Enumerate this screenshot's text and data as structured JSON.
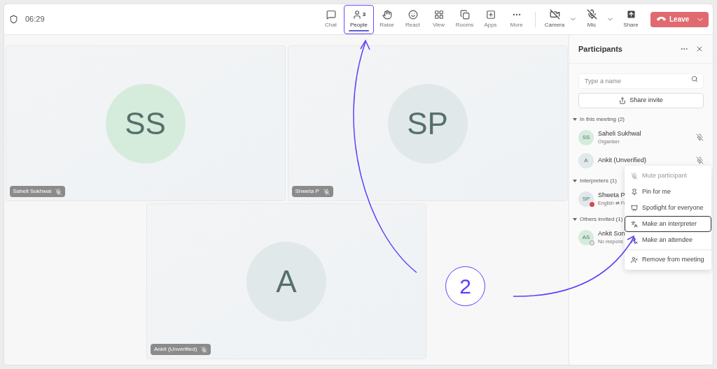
{
  "top_bar": {
    "timer": "06:29",
    "toolbar": [
      {
        "label": "Chat",
        "kind": "chat",
        "selected": false
      },
      {
        "label": "People",
        "kind": "people",
        "badge": "3",
        "selected": true,
        "outlined": true
      },
      {
        "label": "Raise",
        "kind": "raise",
        "selected": false
      },
      {
        "label": "React",
        "kind": "react",
        "selected": false
      },
      {
        "label": "View",
        "kind": "view",
        "selected": false
      },
      {
        "label": "Rooms",
        "kind": "rooms",
        "selected": false
      },
      {
        "label": "Apps",
        "kind": "apps",
        "selected": false
      },
      {
        "label": "More",
        "kind": "more",
        "selected": false
      }
    ],
    "devices": [
      {
        "label": "Camera",
        "kind": "camera",
        "on": false
      },
      {
        "label": "Mic",
        "kind": "mic",
        "on": false
      }
    ],
    "share": "Share",
    "leave": "Leave"
  },
  "tiles": [
    {
      "initials": "SS",
      "name": "Saheli Sukhwal",
      "color": "#d5ecdc",
      "muted": true
    },
    {
      "initials": "SP",
      "name": "Shweta P",
      "color": "#e1e8e9",
      "muted": true
    },
    {
      "initials": "A",
      "name": "Ankit (Unverified)",
      "color": "#e1e8e9",
      "muted": true
    }
  ],
  "panel": {
    "title": "Participants",
    "search": {
      "placeholder": "Type a name"
    },
    "share_invite": "Share invite",
    "sections": [
      {
        "title": "In this meeting (2)",
        "expanded": true,
        "people": [
          {
            "initials": "SS",
            "name": "Saheli Sukhwal",
            "subtitle": "Organiser",
            "color": "#d5ecdc",
            "muted": true
          },
          {
            "initials": "A",
            "name": "Ankit (Unverified)",
            "color": "#e1e8e9",
            "muted": true
          }
        ]
      },
      {
        "title": "Interpreters (1)",
        "expanded": true,
        "people": [
          {
            "initials": "SP",
            "name": "Shweta P",
            "subtitle": "English ⇄ Fr",
            "color": "#e1e8e9",
            "kind": "busy"
          }
        ]
      },
      {
        "title": "Others invited (1)",
        "expanded": true,
        "people": [
          {
            "initials": "AS",
            "name": "Ankit Son",
            "subtitle": "No respons",
            "color": "#d5ecdc",
            "kind": "declined"
          }
        ]
      }
    ]
  },
  "context_menu": {
    "groups": [
      [
        {
          "label": "Mute participant",
          "kind": "mute",
          "disabled": true,
          "focused": false
        },
        {
          "label": "Pin for me",
          "kind": "pin",
          "disabled": false,
          "focused": false
        },
        {
          "label": "Spotlight for everyone",
          "kind": "spotlight",
          "disabled": false,
          "focused": false
        },
        {
          "label": "Make an interpreter",
          "kind": "interpreter",
          "disabled": false,
          "focused": true
        },
        {
          "label": "Make an attendee",
          "kind": "attendee",
          "disabled": false,
          "focused": false
        }
      ],
      [
        {
          "label": "Remove from meeting",
          "kind": "remove",
          "disabled": false,
          "focused": false
        }
      ]
    ]
  },
  "annotation": {
    "step": "2"
  }
}
